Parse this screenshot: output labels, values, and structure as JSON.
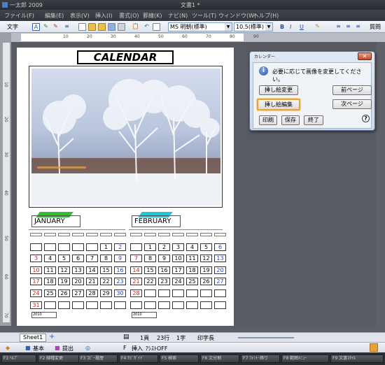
{
  "window": {
    "app_title": "一太郎 2009",
    "doc_title": "文書1 *"
  },
  "menu": [
    "ファイル(F)",
    "編集(E)",
    "表示(V)",
    "挿入(I)",
    "書式(O)",
    "罫線(K)",
    "ナビ(N)",
    "ツール(T)",
    "ウィンドウ(W)",
    "ヘルプ(H)"
  ],
  "toolbar": {
    "mode_label": "文字",
    "font_name": "MS 明朝(標準)",
    "font_size": "10.5(標準)",
    "bold": "B",
    "italic": "I",
    "underline": "U",
    "right_label": "質問"
  },
  "ruler": {
    "top_numbers": [
      "10",
      "20",
      "30",
      "40",
      "50",
      "60",
      "70",
      "80",
      "90"
    ],
    "left_numbers": [
      "10",
      "20",
      "30",
      "40",
      "50",
      "60",
      "70"
    ]
  },
  "calendar": {
    "title": "CALENDAR",
    "year_label": "2010",
    "dow_colors": {
      "weekday": "#000000",
      "sunday": "#cc2222",
      "saturday": "#2244cc"
    },
    "months": [
      {
        "name": "JANUARY",
        "swoosh_color": "#2ec02e",
        "weeks": [
          [
            "",
            "",
            "",
            "",
            "",
            "1",
            "2"
          ],
          [
            "3",
            "4",
            "5",
            "6",
            "7",
            "8",
            "9"
          ],
          [
            "10",
            "11",
            "12",
            "13",
            "14",
            "15",
            "16"
          ],
          [
            "17",
            "18",
            "19",
            "20",
            "21",
            "22",
            "23"
          ],
          [
            "24",
            "25",
            "26",
            "27",
            "28",
            "29",
            "30"
          ],
          [
            "31",
            "",
            "",
            "",
            "",
            "",
            ""
          ]
        ]
      },
      {
        "name": "FEBRUARY",
        "swoosh_color": "#22c8d8",
        "weeks": [
          [
            "",
            "1",
            "2",
            "3",
            "4",
            "5",
            "6"
          ],
          [
            "7",
            "8",
            "9",
            "10",
            "11",
            "12",
            "13"
          ],
          [
            "14",
            "15",
            "16",
            "17",
            "18",
            "19",
            "20"
          ],
          [
            "21",
            "22",
            "23",
            "24",
            "25",
            "26",
            "27"
          ],
          [
            "28",
            "",
            "",
            "",
            "",
            "",
            ""
          ],
          [
            "",
            "",
            "",
            "",
            "",
            "",
            ""
          ]
        ]
      }
    ]
  },
  "dialog": {
    "title": "カレンダー",
    "message": "必要に応じて画像を変更してください。",
    "buttons": {
      "change_illustration": "挿し絵変更",
      "edit_illustration": "挿し絵編集",
      "prev_page": "前ページ",
      "next_page": "次ページ",
      "print": "印刷",
      "save": "保存",
      "finish": "終了",
      "help": "?"
    }
  },
  "sheet": {
    "tab_label": "Sheet1"
  },
  "status": {
    "page": "1頁",
    "line": "23行",
    "char": "1字",
    "insert": "挿入",
    "assist": "ｱｼｽﾄOFF",
    "print_length": "印字長",
    "basic": "基本",
    "submit": "提出",
    "f_label": "F"
  },
  "function_keys": [
    "F1 ﾍﾙﾌﾟ",
    "F2 線種変更",
    "F3 ｺﾋﾟｰ履歴",
    "F4 ﾅﾋﾞｶﾞｲﾄﾞ",
    "F5 検索",
    "F6 文分割",
    "F7 ﾌｫﾝﾄ･飾り",
    "F8 範囲ﾒﾆｭｰ",
    "F9 文書ｽﾀｲﾙ"
  ]
}
